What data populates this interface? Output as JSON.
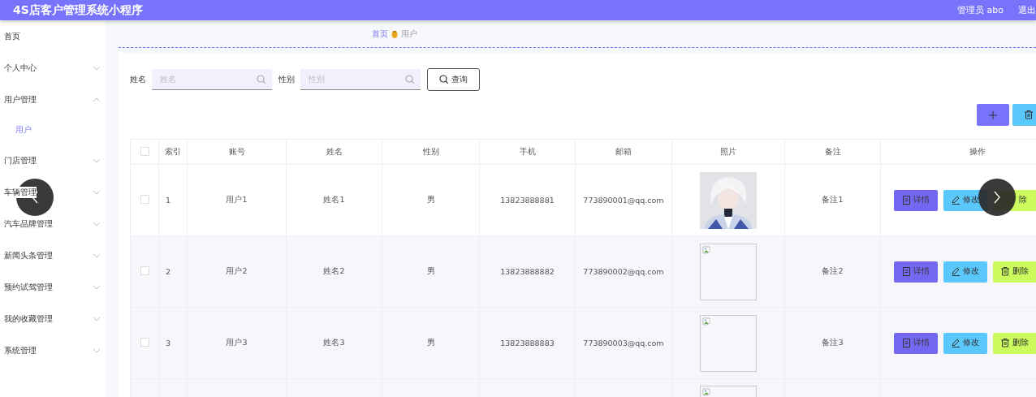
{
  "header": {
    "title": "4S店客户管理系统小程序",
    "user": "管理员 abo",
    "logout": "退出"
  },
  "sidebar": {
    "items": [
      {
        "label": "首页",
        "kind": "link"
      },
      {
        "label": "个人中心",
        "kind": "menu",
        "expanded": false
      },
      {
        "label": "用户管理",
        "kind": "menu",
        "expanded": true,
        "children": [
          {
            "label": "用户",
            "selected": true
          }
        ]
      },
      {
        "label": "门店管理",
        "kind": "menu",
        "expanded": false
      },
      {
        "label": "车辆管理",
        "kind": "menu",
        "expanded": false
      },
      {
        "label": "汽车品牌管理",
        "kind": "menu",
        "expanded": false
      },
      {
        "label": "新闻头条管理",
        "kind": "menu",
        "expanded": false
      },
      {
        "label": "预约试驾管理",
        "kind": "menu",
        "expanded": false
      },
      {
        "label": "我的收藏管理",
        "kind": "menu",
        "expanded": false
      },
      {
        "label": "系统管理",
        "kind": "menu",
        "expanded": false
      }
    ]
  },
  "breadcrumb": [
    {
      "label": "首页"
    },
    {
      "label": "用户"
    }
  ],
  "search": {
    "fields": [
      {
        "label": "姓名",
        "placeholder": "姓名"
      },
      {
        "label": "性别",
        "placeholder": "性别"
      }
    ],
    "button": "查询"
  },
  "toolbar": [
    {
      "kind": "add"
    },
    {
      "kind": "delete"
    }
  ],
  "table": {
    "all_checked": false,
    "columns": [
      "索引",
      "账号",
      "姓名",
      "性别",
      "手机",
      "邮箱",
      "照片",
      "备注",
      "操作"
    ],
    "rows": [
      {
        "checked": false,
        "cells": [
          "1",
          "用户1",
          "姓名1",
          "男",
          "13823888881",
          "773890001@qq.com"
        ],
        "photo": {
          "kind": "picture"
        },
        "remark": "备注1",
        "actions": [
          {
            "kind": "detail",
            "label": "详情",
            "icon": true
          },
          {
            "kind": "edit",
            "label": "修改",
            "icon": true
          },
          {
            "kind": "delete",
            "label": "除",
            "icon": false
          }
        ]
      },
      {
        "checked": false,
        "cells": [
          "2",
          "用户2",
          "姓名2",
          "男",
          "13823888882",
          "773890002@qq.com"
        ],
        "photo": {
          "kind": "broken"
        },
        "remark": "备注2",
        "actions": [
          {
            "kind": "detail",
            "label": "详情",
            "icon": true
          },
          {
            "kind": "edit",
            "label": "修改",
            "icon": true
          },
          {
            "kind": "delete",
            "label": "删除",
            "icon": true
          }
        ]
      },
      {
        "checked": false,
        "cells": [
          "3",
          "用户3",
          "姓名3",
          "男",
          "13823888883",
          "773890003@qq.com"
        ],
        "photo": {
          "kind": "broken"
        },
        "remark": "备注3",
        "actions": [
          {
            "kind": "detail",
            "label": "详情",
            "icon": true
          },
          {
            "kind": "edit",
            "label": "修改",
            "icon": true
          },
          {
            "kind": "delete",
            "label": "删除",
            "icon": true
          }
        ]
      },
      {
        "photo": {
          "kind": "broken"
        }
      }
    ]
  },
  "viewer": {
    "prev": true,
    "next": true
  }
}
